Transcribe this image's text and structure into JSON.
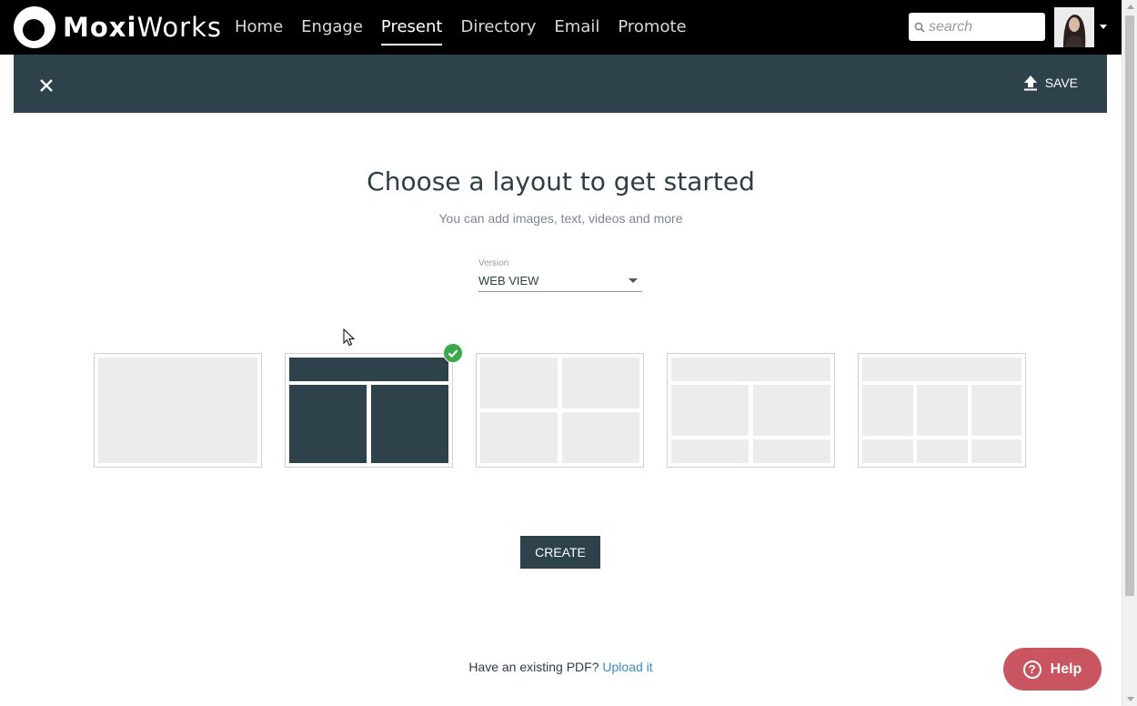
{
  "brand": {
    "logo_bold": "Moxi",
    "logo_light": "Works"
  },
  "nav": {
    "items": [
      {
        "label": "Home",
        "active": false
      },
      {
        "label": "Engage",
        "active": false
      },
      {
        "label": "Present",
        "active": true
      },
      {
        "label": "Directory",
        "active": false
      },
      {
        "label": "Email",
        "active": false
      },
      {
        "label": "Promote",
        "active": false
      }
    ],
    "search_placeholder": "search"
  },
  "toolbar": {
    "save_label": "SAVE"
  },
  "main": {
    "heading": "Choose a layout to get started",
    "subheading": "You can add images, text, videos and more",
    "version_label": "Version",
    "version_value": "WEB VIEW",
    "create_label": "CREATE",
    "pdf_text": "Have an existing PDF?",
    "pdf_link": "Upload it"
  },
  "help": {
    "label": "Help",
    "icon_glyph": "?"
  },
  "colors": {
    "toolbar_bg": "#2e424c",
    "accent_link": "#3a8bbd",
    "help_bg": "#c8555f",
    "check_green": "#3aa84b"
  }
}
